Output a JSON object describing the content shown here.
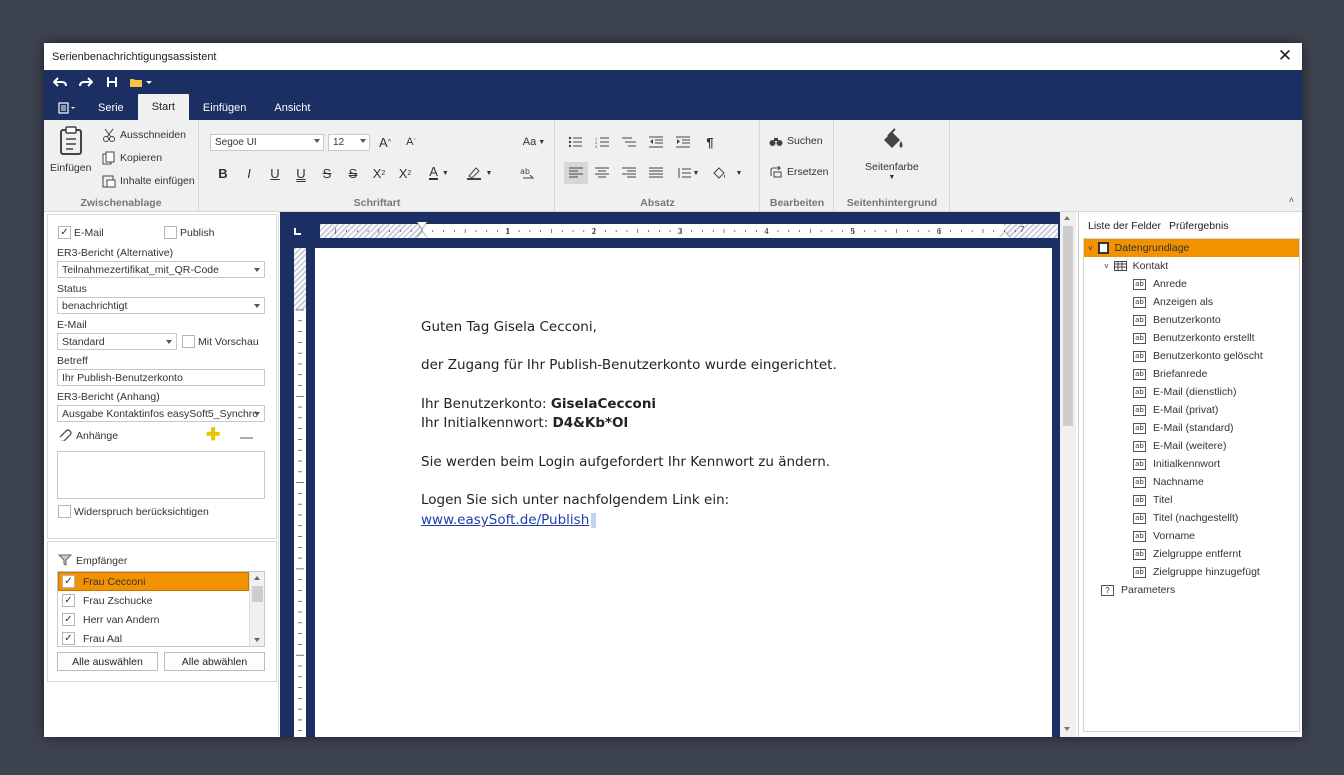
{
  "window": {
    "title": "Serienbenachrichtigungsassistent",
    "close": "✕"
  },
  "tabs": [
    "Serie",
    "Start",
    "Einfügen",
    "Ansicht"
  ],
  "ribbon": {
    "clipboard": {
      "paste": "Einfügen",
      "cut": "Ausschneiden",
      "copy": "Kopieren",
      "paste_content": "Inhalte einfügen",
      "label": "Zwischenablage"
    },
    "font": {
      "family": "Segoe UI",
      "size": "12",
      "label": "Schriftart",
      "case": "Aa"
    },
    "paragraph": {
      "label": "Absatz"
    },
    "edit": {
      "search": "Suchen",
      "replace": "Ersetzen",
      "label": "Bearbeiten"
    },
    "background": {
      "page_color": "Seitenfarbe",
      "label": "Seitenhintergrund"
    }
  },
  "left": {
    "email_check_label": "E-Mail",
    "publish_check_label": "Publish",
    "er3_alt_label": "ER3-Bericht (Alternative)",
    "er3_alt_value": "Teilnahmezertifikat_mit_QR-Code",
    "status_label": "Status",
    "status_value": "benachrichtigt",
    "email_label": "E-Mail",
    "email_value": "Standard",
    "preview_label": "Mit Vorschau",
    "subject_label": "Betreff",
    "subject_value": "Ihr Publish-Benutzerkonto",
    "er3_attach_label": "ER3-Bericht (Anhang)",
    "er3_attach_value": "Ausgabe Kontaktinfos easySoft5_Synchro",
    "attachments_label": "Anhänge",
    "objection_label": "Widerspruch berücksichtigen",
    "recipients_label": "Empfänger",
    "recipients": [
      "Frau Cecconi",
      "Frau Zschucke",
      "Herr van Andern",
      "Frau Aal"
    ],
    "select_all": "Alle auswählen",
    "deselect_all": "Alle abwählen"
  },
  "ruler": {
    "marks": [
      "1",
      "2",
      "3",
      "4",
      "5",
      "6",
      "7"
    ]
  },
  "document": {
    "greeting": "Guten Tag Gisela Cecconi,",
    "line1": "der Zugang für Ihr Publish-Benutzerkonto wurde eingerichtet.",
    "account_prefix": "Ihr Benutzerkonto: ",
    "account_value": "GiselaCecconi",
    "password_prefix": "Ihr Initialkennwort: ",
    "password_value": "D4&Kb*Ol",
    "line3": "Sie werden beim Login aufgefordert Ihr Kennwort zu ändern.",
    "line4": "Logen Sie sich unter nachfolgendem Link ein:",
    "link": "www.easySoft.de/Publish"
  },
  "right": {
    "tab_fields": "Liste der Felder",
    "tab_check": "Prüfergebnis",
    "root": "Datengrundlage",
    "contact": "Kontakt",
    "fields": [
      "Anrede",
      "Anzeigen als",
      "Benutzerkonto",
      "Benutzerkonto erstellt",
      "Benutzerkonto gelöscht",
      "Briefanrede",
      "E-Mail (dienstlich)",
      "E-Mail (privat)",
      "E-Mail (standard)",
      "E-Mail (weitere)",
      "Initialkennwort",
      "Nachname",
      "Titel",
      "Titel (nachgestellt)",
      "Vorname",
      "Zielgruppe entfernt",
      "Zielgruppe hinzugefügt"
    ],
    "field_icon": "ab",
    "params": "Parameters"
  },
  "colors": {
    "accent": "#f39200",
    "nav": "#1c2f63"
  }
}
